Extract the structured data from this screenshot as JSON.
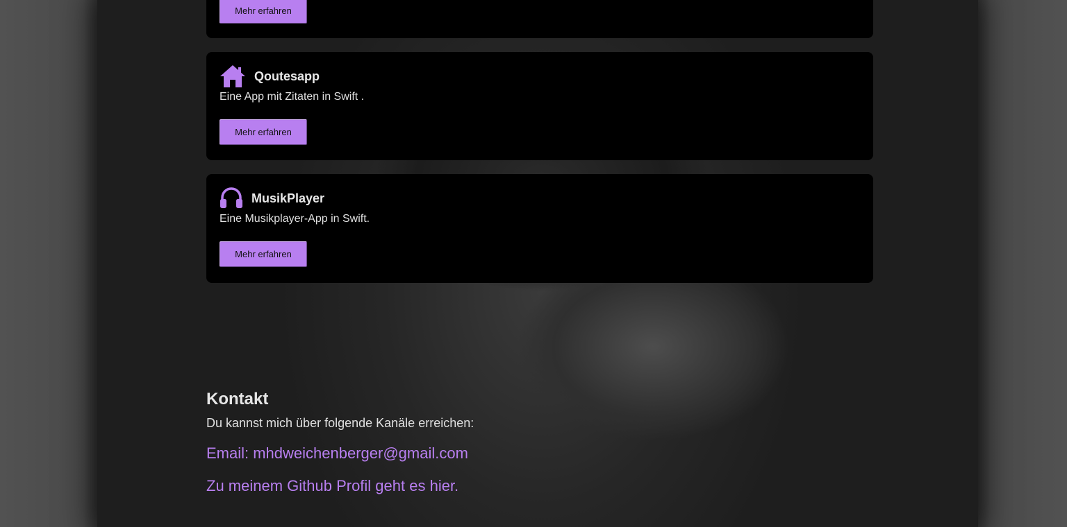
{
  "projects": [
    {
      "title": "",
      "description": "",
      "icon": "",
      "button_label": "Mehr erfahren"
    },
    {
      "title": "Qoutesapp",
      "description": "Eine App mit Zitaten in Swift .",
      "icon": "house-icon",
      "button_label": "Mehr erfahren"
    },
    {
      "title": "MusikPlayer",
      "description": "Eine Musikplayer-App in Swift.",
      "icon": "headphones-icon",
      "button_label": "Mehr erfahren"
    }
  ],
  "contact": {
    "title": "Kontakt",
    "text": "Du kannst mich über folgende Kanäle erreichen:",
    "email_link": "Email: mhdweichenberger@gmail.com",
    "github_link": "Zu meinem Github Profil geht es hier."
  },
  "colors": {
    "accent": "#b87ff0",
    "card_background": "#000000",
    "page_background": "#4a4a4a"
  }
}
